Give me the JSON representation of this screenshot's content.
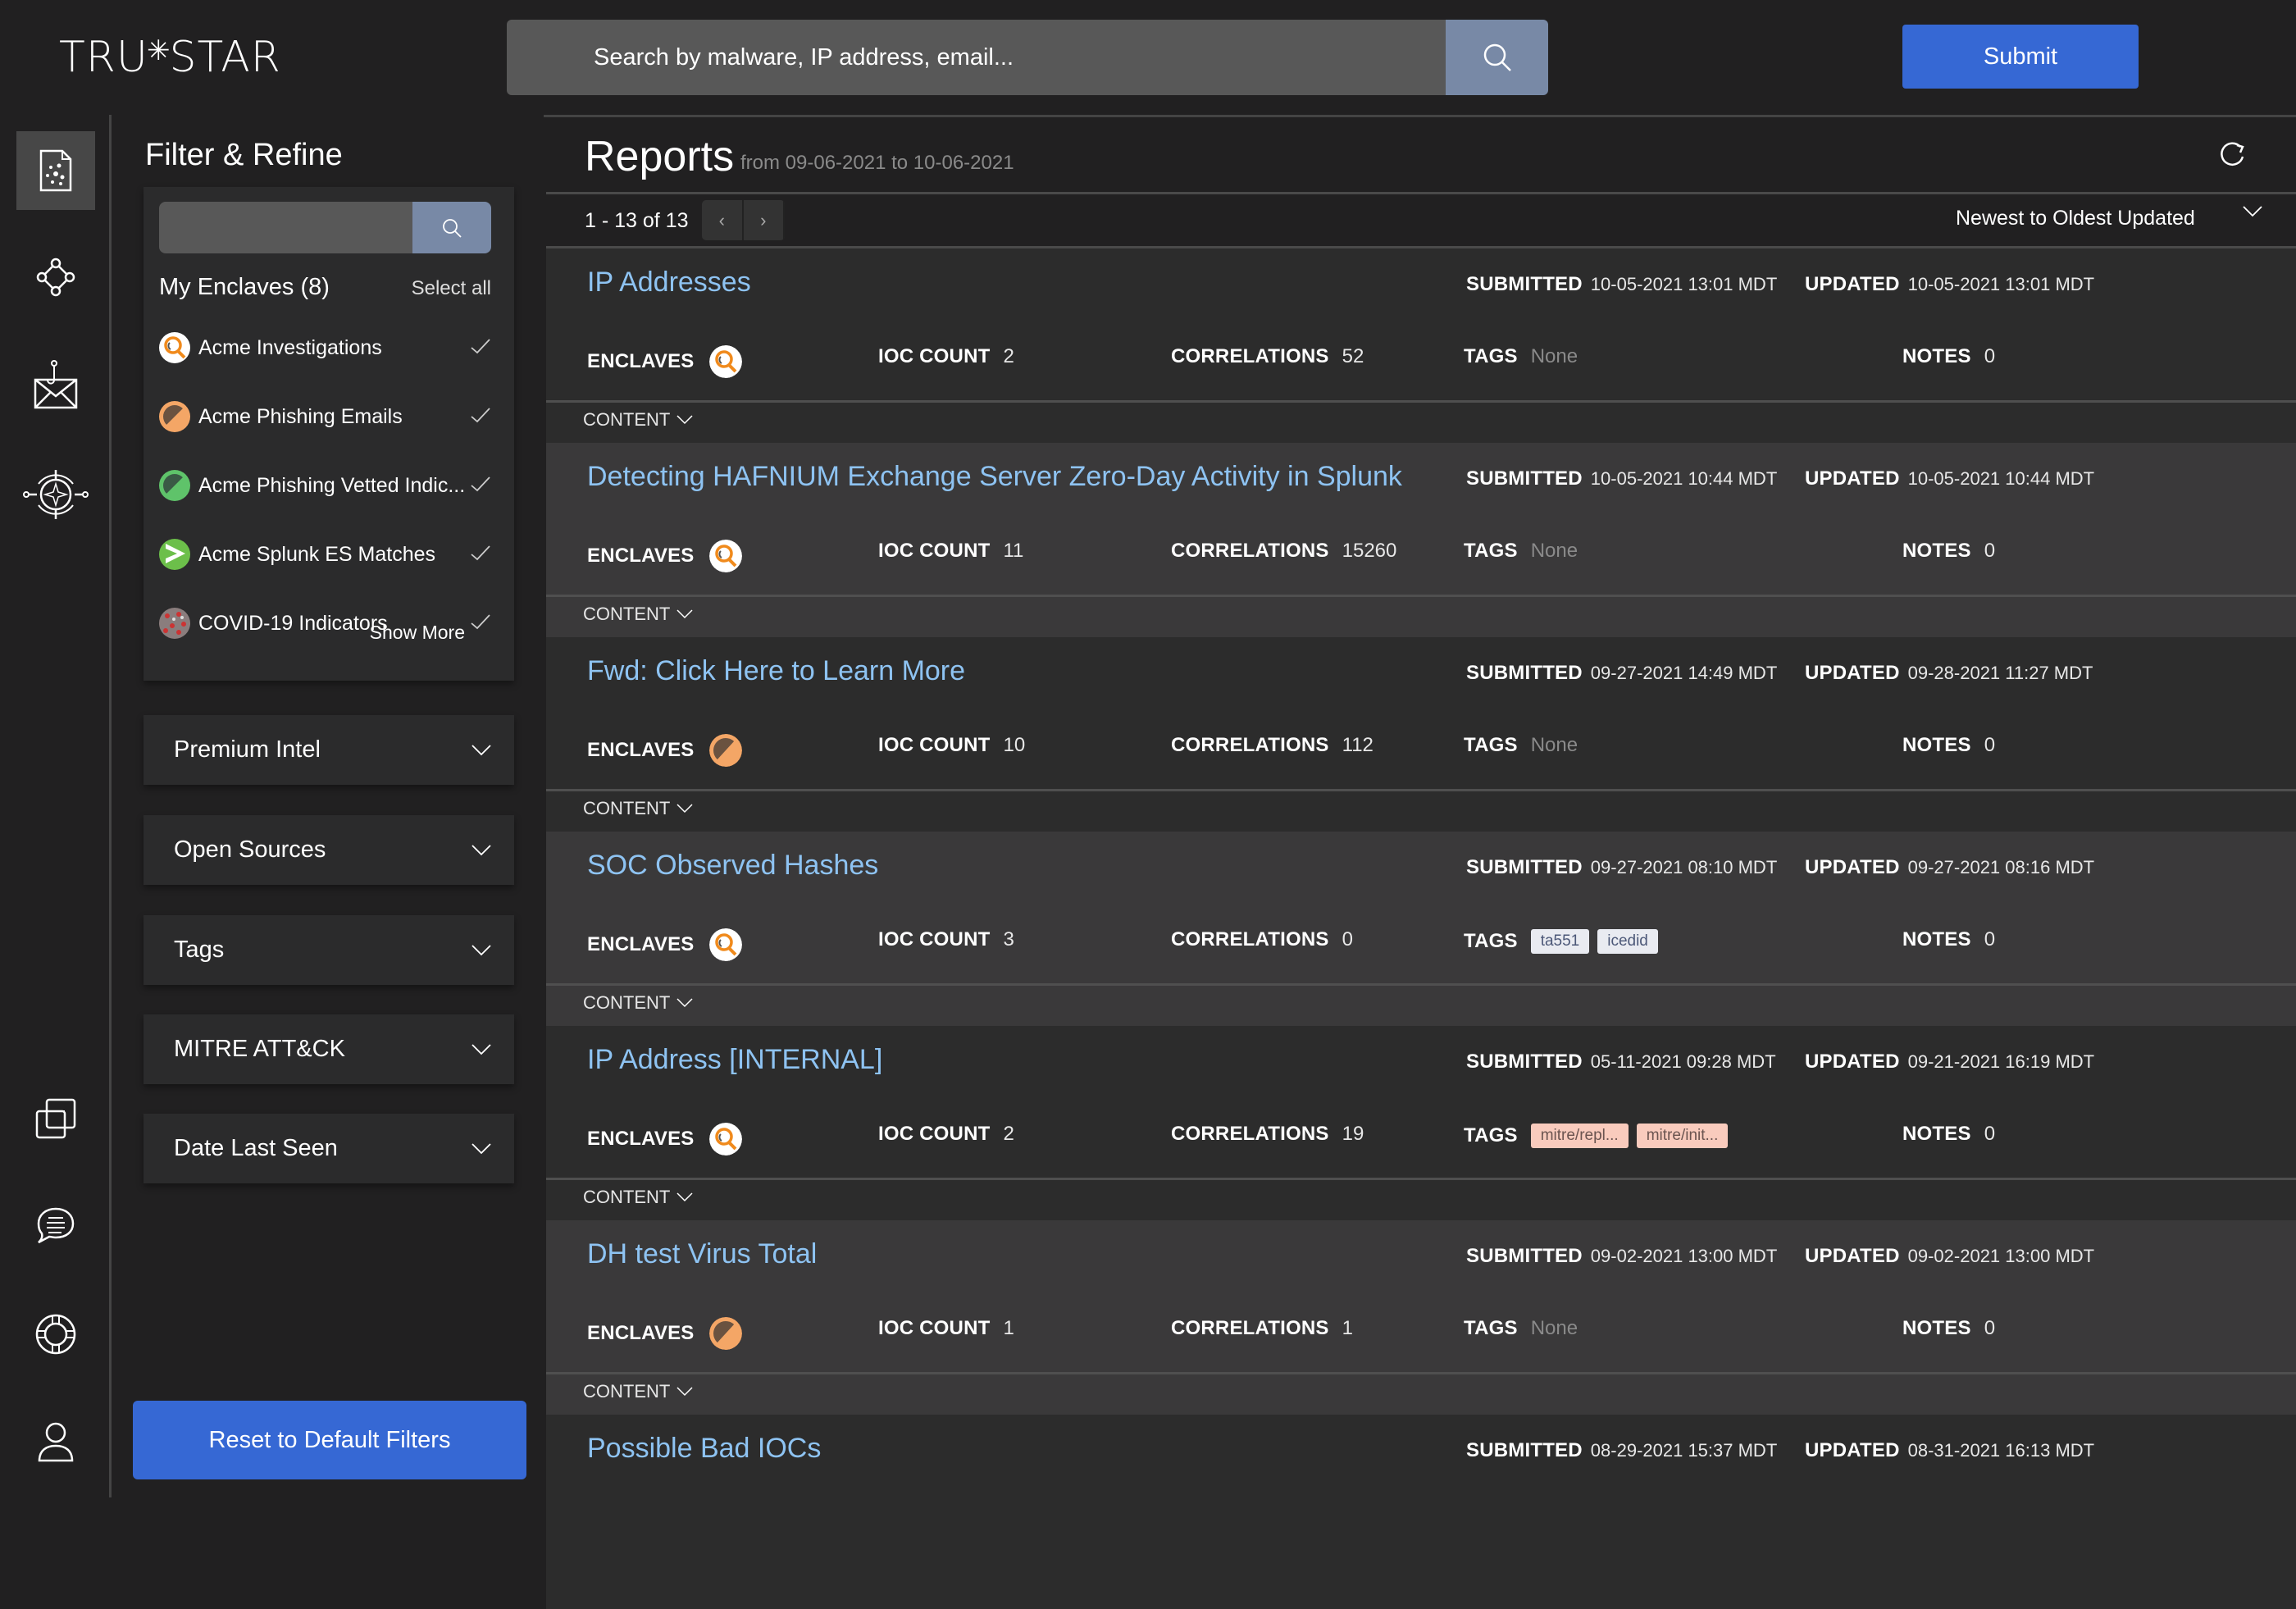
{
  "app": {
    "logo": "TRU*STAR",
    "search_placeholder": "Search by malware, IP address, email...",
    "submit_label": "Submit"
  },
  "rail": {
    "top_icons": [
      "reports-icon",
      "graph-icon",
      "phishing-icon",
      "compass-icon"
    ],
    "bottom_icons": [
      "copy-icon",
      "chat-icon",
      "help-icon",
      "user-icon"
    ]
  },
  "filter": {
    "title": "Filter & Refine",
    "enclaves_title": "My Enclaves (8)",
    "select_all": "Select all",
    "enclaves": [
      {
        "label": "Acme Investigations",
        "icon": "magnifier",
        "checked": true
      },
      {
        "label": "Acme Phishing Emails",
        "icon": "orange-split",
        "checked": true
      },
      {
        "label": "Acme Phishing Vetted Indic...",
        "icon": "green-split",
        "checked": true
      },
      {
        "label": "Acme Splunk ES Matches",
        "icon": "splunk",
        "checked": true
      },
      {
        "label": "COVID-19 Indicators",
        "icon": "covid",
        "checked": true
      }
    ],
    "show_more": "Show More",
    "accordions": [
      "Premium Intel",
      "Open Sources",
      "Tags",
      "MITRE ATT&CK",
      "Date Last Seen"
    ],
    "reset_label": "Reset to Default Filters"
  },
  "reports": {
    "title": "Reports",
    "range": "from 09-06-2021 to 10-06-2021",
    "pager": "1 - 13 of 13",
    "sort": "Newest to Oldest Updated",
    "labels": {
      "submitted": "SUBMITTED",
      "updated": "UPDATED",
      "enclaves": "ENCLAVES",
      "ioc_count": "IOC COUNT",
      "correlations": "CORRELATIONS",
      "tags": "TAGS",
      "notes": "NOTES",
      "content": "CONTENT",
      "none": "None"
    },
    "items": [
      {
        "title": "IP Addresses",
        "submitted": "10-05-2021 13:01 MDT",
        "updated": "10-05-2021 13:01 MDT",
        "enclave_icon": "magnifier",
        "ioc_count": "2",
        "correlations": "52",
        "tags": [],
        "notes": "0"
      },
      {
        "title": "Detecting HAFNIUM Exchange Server Zero-Day Activity in Splunk",
        "submitted": "10-05-2021 10:44 MDT",
        "updated": "10-05-2021 10:44 MDT",
        "enclave_icon": "magnifier",
        "ioc_count": "11",
        "correlations": "15260",
        "tags": [],
        "notes": "0"
      },
      {
        "title": "Fwd: Click Here to Learn More",
        "submitted": "09-27-2021 14:49 MDT",
        "updated": "09-28-2021 11:27 MDT",
        "enclave_icon": "orange-split",
        "ioc_count": "10",
        "correlations": "112",
        "tags": [],
        "notes": "0"
      },
      {
        "title": "SOC Observed Hashes",
        "submitted": "09-27-2021 08:10 MDT",
        "updated": "09-27-2021 08:16 MDT",
        "enclave_icon": "magnifier",
        "ioc_count": "3",
        "correlations": "0",
        "tags": [
          {
            "label": "ta551",
            "style": "grey"
          },
          {
            "label": "icedid",
            "style": "grey"
          }
        ],
        "notes": "0"
      },
      {
        "title": "IP Address [INTERNAL]",
        "submitted": "05-11-2021 09:28 MDT",
        "updated": "09-21-2021 16:19 MDT",
        "enclave_icon": "magnifier",
        "ioc_count": "2",
        "correlations": "19",
        "tags": [
          {
            "label": "mitre/repl...",
            "style": "pink"
          },
          {
            "label": "mitre/init...",
            "style": "pink"
          }
        ],
        "notes": "0"
      },
      {
        "title": "DH test Virus Total",
        "submitted": "09-02-2021 13:00 MDT",
        "updated": "09-02-2021 13:00 MDT",
        "enclave_icon": "orange-split",
        "ioc_count": "1",
        "correlations": "1",
        "tags": [],
        "notes": "0"
      },
      {
        "title": "Possible Bad IOCs",
        "submitted": "08-29-2021 15:37 MDT",
        "updated": "08-31-2021 16:13 MDT"
      }
    ]
  },
  "colors": {
    "accent_blue": "#3668d4",
    "link_blue": "#8ec3f2",
    "search_btn": "#7889a6"
  }
}
